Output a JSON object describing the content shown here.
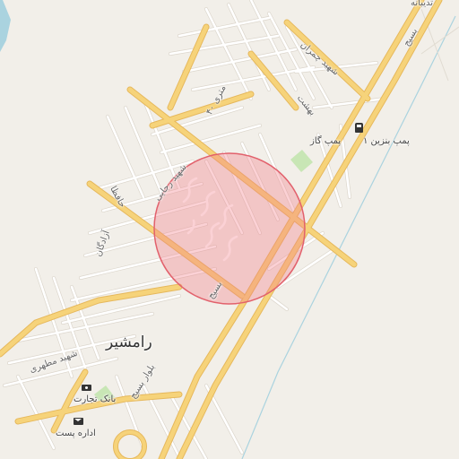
{
  "map": {
    "colors": {
      "background": "#f2efe9",
      "major_road": "#f6d37a",
      "major_road_casing": "#e6b85c",
      "minor_road": "#ffffff",
      "minor_road_casing": "#dcd6cc",
      "water": "#aad3df",
      "park": "#c8e6b5",
      "highlight_fill": "#f47c86",
      "highlight_stroke": "#e2616c"
    },
    "labels": {
      "city": "رامشیر",
      "top_right": "تدیبانه",
      "shahid_chamran": "شهید چمران",
      "behesht": "بهشت",
      "mehri_40": "۴۰ متری",
      "shahid_rajaei": "شهید رجایی",
      "hafeza": "حافظا",
      "azadegan": "آزادگان",
      "basij_upper": "بسیج",
      "basij_mid": "بسیج",
      "bolvar_basij": "بلوار بسیج",
      "shahid_motahari": "شهید مطهری"
    },
    "pois": {
      "fuel_1": "پمپ بنزین ۱",
      "fuel_2": "پمپ گاز",
      "bank": "بانک تجارت",
      "post": "اداره پست"
    },
    "icons": {
      "fuel": "fuel-pump-icon",
      "bank": "bank-icon",
      "post": "post-office-icon"
    }
  }
}
